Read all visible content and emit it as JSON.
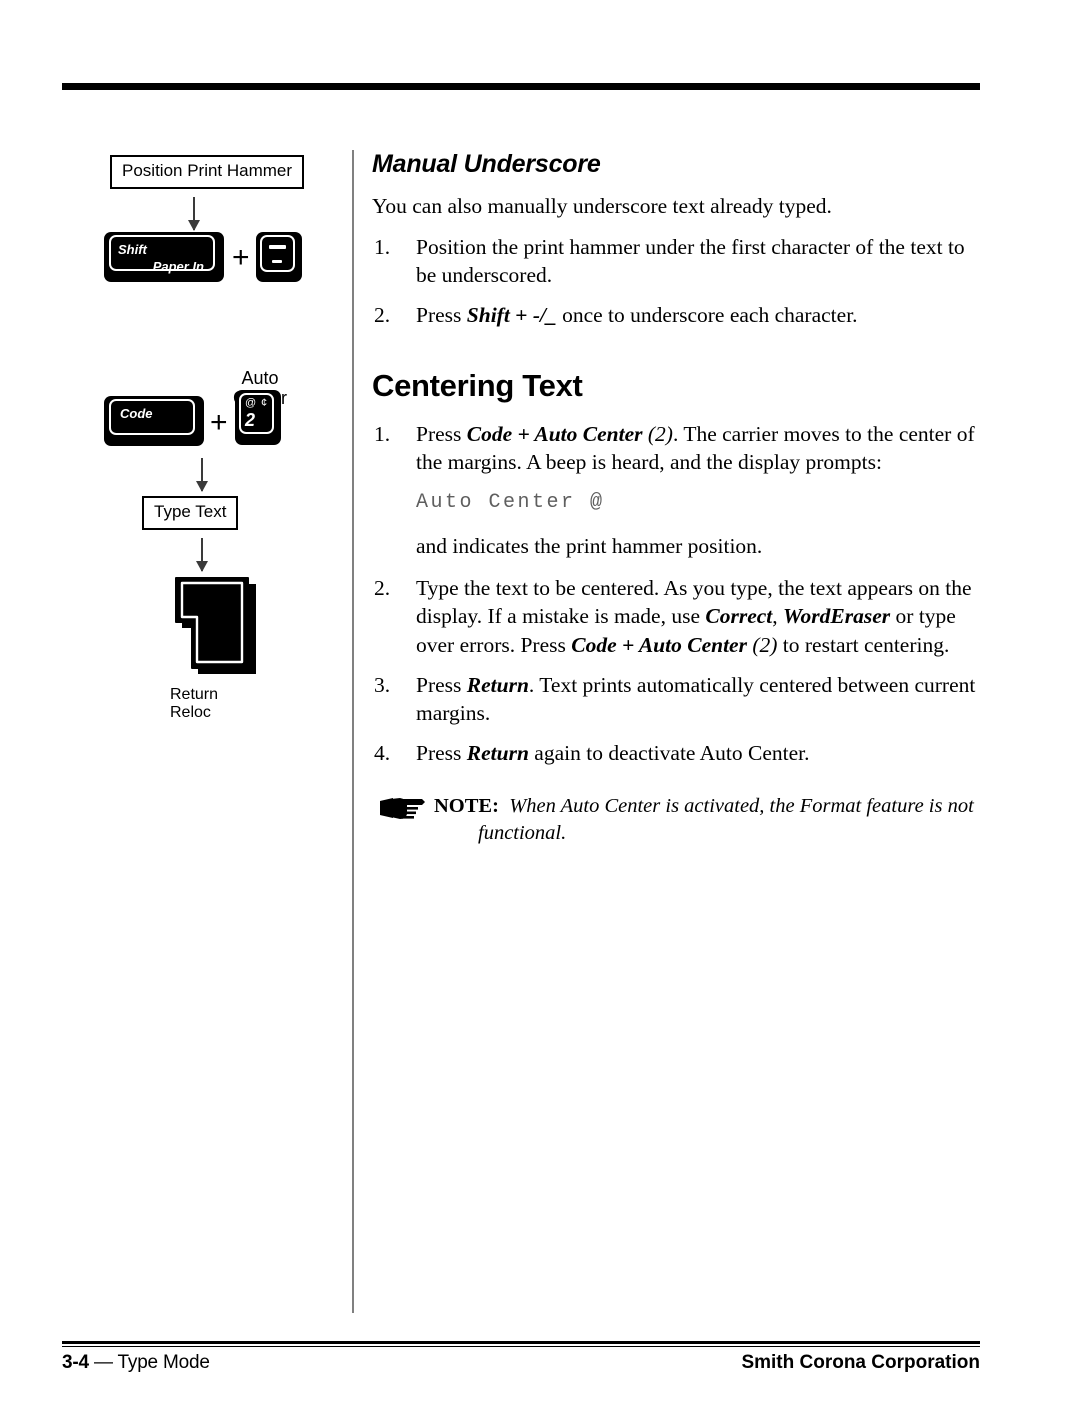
{
  "document": {
    "top_rule": true,
    "footer": {
      "page_number": "3-4",
      "separator": "—",
      "section": "Type Mode",
      "company": "Smith Corona Corporation"
    }
  },
  "diagrams": [
    {
      "id": "manual-underscore-diagram",
      "box_label": "Position Print Hammer",
      "keys": [
        {
          "name": "shift-paper-in-key",
          "labels": [
            "Shift",
            "Paper In"
          ]
        },
        {
          "name": "hyphen-underscore-key",
          "labels": [
            "—",
            "-"
          ]
        }
      ],
      "operator": "+"
    },
    {
      "id": "centering-text-diagram",
      "caption": "Auto\nCenter",
      "keys": [
        {
          "name": "code-key",
          "labels": [
            "Code"
          ]
        },
        {
          "name": "two-key",
          "labels": [
            "@",
            "¢",
            "2"
          ]
        }
      ],
      "operator": "+",
      "box_label": "Type Text",
      "return_key": {
        "name": "return-reloc-key",
        "labels": [
          "Return",
          "Reloc"
        ]
      }
    }
  ],
  "content": {
    "manual_underscore": {
      "heading": "Manual Underscore",
      "intro": "You can also manually underscore text already typed.",
      "steps": [
        {
          "num": "1.",
          "parts": [
            {
              "text": "Position the print hammer under the first character of the text to be underscored.",
              "style": "normal"
            }
          ]
        },
        {
          "num": "2.",
          "parts": [
            {
              "text": "Press ",
              "style": "normal"
            },
            {
              "text": "Shift",
              "style": "bold-italic"
            },
            {
              "text": " + ",
              "style": "bold"
            },
            {
              "text": "-/_",
              "style": "bold-italic"
            },
            {
              "text": " once to underscore each character.",
              "style": "normal"
            }
          ]
        }
      ]
    },
    "centering_text": {
      "heading": "Centering Text",
      "steps": [
        {
          "num": "1.",
          "parts": [
            {
              "text": "Press ",
              "style": "normal"
            },
            {
              "text": "Code + Auto Center",
              "style": "bold-italic"
            },
            {
              "text": " (2)",
              "style": "italic"
            },
            {
              "text": ". The carrier moves to the center of the margins. A beep is heard, and the display prompts:",
              "style": "normal"
            }
          ]
        },
        {
          "num": "2.",
          "parts": [
            {
              "text": "Type the text to be centered. As you type, the text appears on the display. If a mistake is made, use ",
              "style": "normal"
            },
            {
              "text": "Correct",
              "style": "bold-italic"
            },
            {
              "text": ", ",
              "style": "normal"
            },
            {
              "text": "WordEraser",
              "style": "bold-italic"
            },
            {
              "text": " or type over errors. Press ",
              "style": "normal"
            },
            {
              "text": "Code + Auto Center",
              "style": "bold-italic"
            },
            {
              "text": " (2)",
              "style": "italic"
            },
            {
              "text": " to restart centering.",
              "style": "normal"
            }
          ]
        },
        {
          "num": "3.",
          "parts": [
            {
              "text": "Press ",
              "style": "normal"
            },
            {
              "text": "Return",
              "style": "bold-italic"
            },
            {
              "text": ". Text prints automatically centered between current margins.",
              "style": "normal"
            }
          ]
        },
        {
          "num": "4.",
          "parts": [
            {
              "text": "Press ",
              "style": "normal"
            },
            {
              "text": "Return",
              "style": "bold-italic"
            },
            {
              "text": " again to deactivate Auto Center.",
              "style": "normal"
            }
          ]
        }
      ],
      "display_prompt": "Auto Center @",
      "prompt_follow_up": "and indicates the print hammer position.",
      "note": {
        "icon": "pointing-hand-icon",
        "label": "NOTE:",
        "text_line1": "When Auto Center is activated, the Format feature is not",
        "text_line2": "functional."
      }
    }
  },
  "colors": {
    "ink": "#000000",
    "divider": "#808080",
    "prompt_gray": "#5f5f5f",
    "key_fill": "#000000",
    "key_outline": "#ffffff"
  }
}
